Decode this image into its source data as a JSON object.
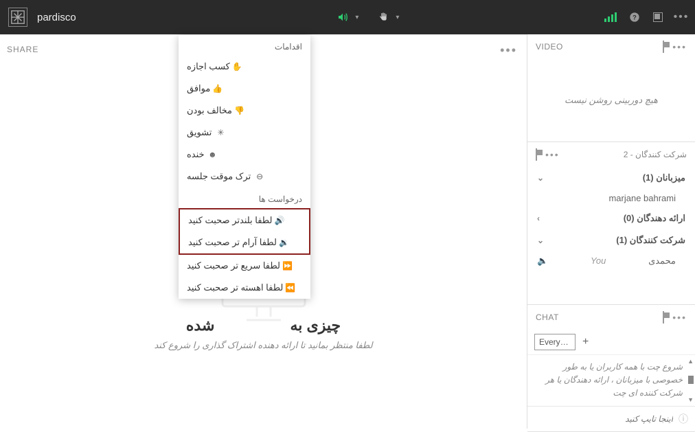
{
  "topbar": {
    "room_name": "pardisco"
  },
  "share": {
    "label": "SHARE",
    "title_visible": "شده",
    "title_prefix": "چیزی به",
    "subtitle": "لطفا منتظر بمانید تا ارائه دهنده اشتراک گذاری را شروع کند"
  },
  "dropdown": {
    "section1": "اقدامات",
    "items1": [
      "کسب اجازه",
      "موافق",
      "مخالف بودن",
      "تشویق",
      "خنده",
      "ترک موقت جلسه"
    ],
    "section2": "درخواست ها",
    "items2": [
      "لطفا بلندتر صحبت کنید",
      "لطفا آرام تر صحبت کنید",
      "لطفا سریع تر صحبت کنید",
      "لطفا اهسته تر صحبت کنید"
    ]
  },
  "video": {
    "label": "VIDEO",
    "empty": "هیچ دوربینی روشن نیست"
  },
  "participants": {
    "label": "شرکت کنندگان",
    "count": "2",
    "groups": {
      "hosts": "میزبانان (1)",
      "host_user": "marjane bahrami",
      "presenters": "ارائه دهندگان (0)",
      "attendees": "شرکت کنندگان (1)",
      "attendee_user": "محمدی",
      "you": "You"
    }
  },
  "chat": {
    "label": "CHAT",
    "tab": "Everyo…",
    "hint": "شروع چت با همه کاربران یا به طور خصوصی با میزبانان ، ارائه دهندگان یا هر شرکت کننده ای چت",
    "placeholder": "اینجا تایپ کنید"
  }
}
